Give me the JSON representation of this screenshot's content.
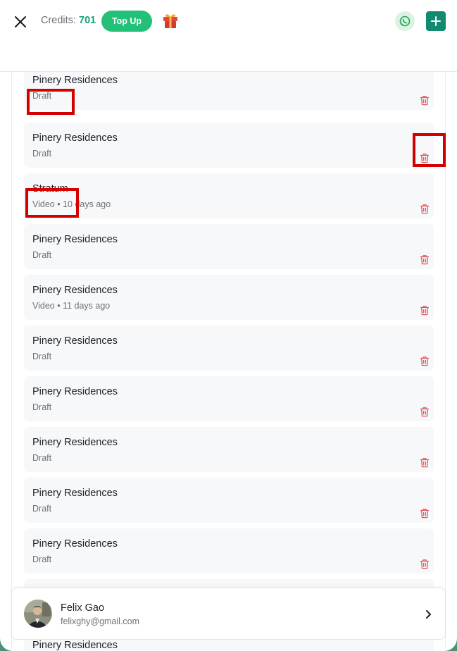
{
  "header": {
    "credits_label": "Credits:",
    "credits_value": "701",
    "topup_label": "Top Up",
    "icons": {
      "close": "close-icon",
      "gift": "gift-icon",
      "whatsapp": "whatsapp-icon",
      "add": "plus-icon"
    }
  },
  "projects": [
    {
      "title": "Pinery Residences",
      "meta": "Draft"
    },
    {
      "title": "Pinery Residences",
      "meta": "Draft"
    },
    {
      "title": "Stratum",
      "meta": "Video • 10 days ago"
    },
    {
      "title": "Pinery Residences",
      "meta": "Draft"
    },
    {
      "title": "Pinery Residences",
      "meta": "Video • 11 days ago"
    },
    {
      "title": "Pinery Residences",
      "meta": "Draft"
    },
    {
      "title": "Pinery Residences",
      "meta": "Draft"
    },
    {
      "title": "Pinery Residences",
      "meta": "Draft"
    },
    {
      "title": "Pinery Residences",
      "meta": "Draft"
    },
    {
      "title": "Pinery Residences",
      "meta": "Draft"
    },
    {
      "title": "",
      "meta": ""
    },
    {
      "title": "Pinery Residences",
      "meta": ""
    }
  ],
  "profile": {
    "name": "Felix Gao",
    "email": "felixghy@gmail.com"
  },
  "colors": {
    "accent_green": "#22c177",
    "credits_value": "#16a37b",
    "add_button": "#118a70",
    "trash_icon": "#e0575d",
    "annotation_box": "#d40000",
    "item_background": "#f7f8fa"
  }
}
